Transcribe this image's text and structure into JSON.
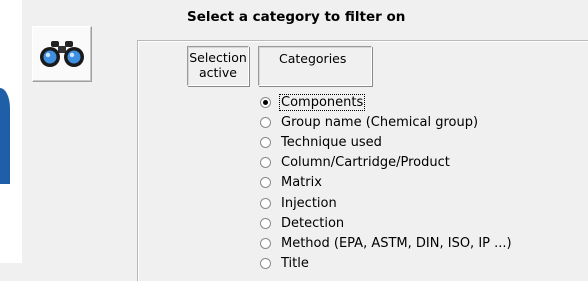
{
  "dialog": {
    "title": "Select a category to filter on",
    "selection_active_line1": "Selection",
    "selection_active_line2": "active",
    "categories_header": "Categories"
  },
  "toolbar": {
    "icon": "binoculars-icon"
  },
  "colors": {
    "accent_blue": "#1f5fa8",
    "background": "#f0f0f0"
  },
  "options": [
    {
      "label": "Components",
      "selected": true
    },
    {
      "label": "Group name (Chemical group)",
      "selected": false
    },
    {
      "label": "Technique used",
      "selected": false
    },
    {
      "label": "Column/Cartridge/Product",
      "selected": false
    },
    {
      "label": "Matrix",
      "selected": false
    },
    {
      "label": "Injection",
      "selected": false
    },
    {
      "label": "Detection",
      "selected": false
    },
    {
      "label": "Method (EPA, ASTM, DIN, ISO, IP ...)",
      "selected": false
    },
    {
      "label": "Title",
      "selected": false
    }
  ]
}
